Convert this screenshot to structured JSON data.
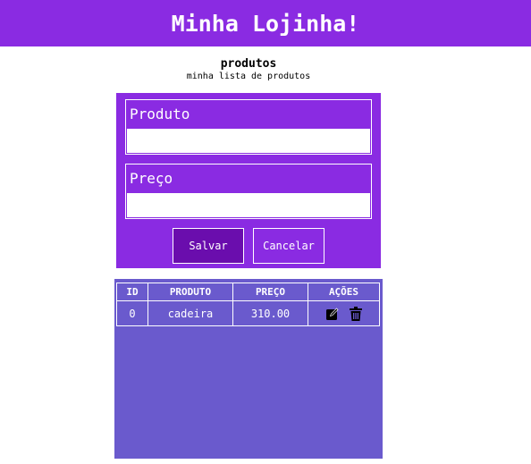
{
  "header": {
    "title": "Minha Lojinha!"
  },
  "page": {
    "title": "produtos",
    "subtitle": "minha lista de produtos"
  },
  "form": {
    "fields": [
      {
        "label": "Produto",
        "value": ""
      },
      {
        "label": "Preço",
        "value": ""
      }
    ],
    "save_label": "Salvar",
    "cancel_label": "Cancelar"
  },
  "table": {
    "columns": [
      "ID",
      "PRODUTO",
      "PREÇO",
      "AÇÕES"
    ],
    "rows": [
      {
        "id": "0",
        "produto": "cadeira",
        "preco": "310.00",
        "actions": [
          "edit-icon",
          "trash-icon"
        ]
      }
    ]
  },
  "colors": {
    "header_bg": "#8a2be2",
    "form_bg": "#8a2be2",
    "save_button_bg": "#6a0dad",
    "table_bg": "#6a5acd"
  }
}
